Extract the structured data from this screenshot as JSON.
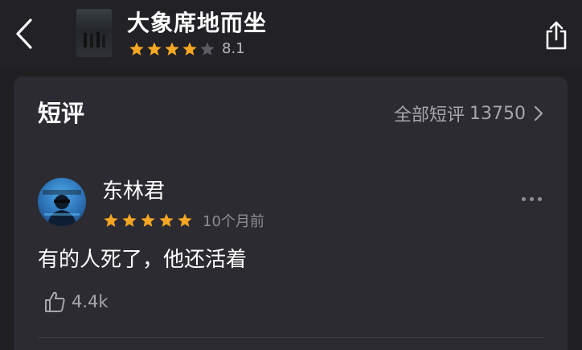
{
  "header": {
    "back_icon": "chevron-left-icon",
    "title": "大象席地而坐",
    "rating_stars": 4,
    "rating_max": 5,
    "score": "8.1",
    "share_icon": "share-icon",
    "star_color": "#f5a623",
    "star_empty_color": "#5c5c62"
  },
  "card": {
    "section_title": "短评",
    "all_reviews_label": "全部短评",
    "all_reviews_count": "13750",
    "chevron_icon": "chevron-right-icon"
  },
  "review": {
    "username": "东林君",
    "rating_stars": 5,
    "time": "10个月前",
    "text": "有的人死了，他还活着",
    "like_icon": "thumbs-up-icon",
    "like_count": "4.4k",
    "more_icon": "more-dots-icon"
  }
}
